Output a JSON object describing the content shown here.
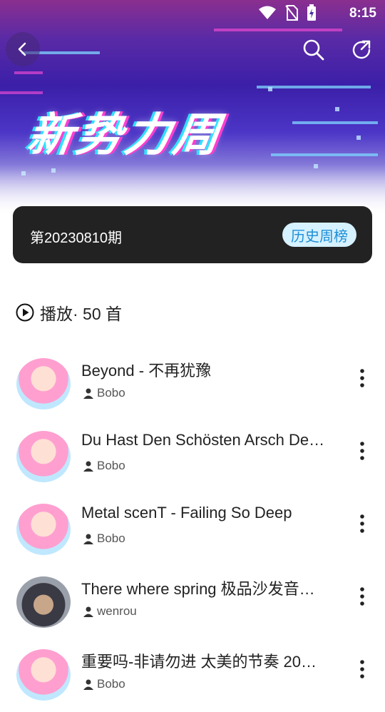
{
  "status": {
    "time": "8:15"
  },
  "header": {
    "banner_title": "新势力周",
    "icons": {
      "back": "back-chevron-icon",
      "search": "search-icon",
      "share": "share-icon"
    }
  },
  "period": {
    "label": "第20230810期",
    "history_button": "历史周榜"
  },
  "play_all": {
    "label": "播放· 50 首",
    "icon": "play-circle-icon"
  },
  "songs": [
    {
      "title": "Beyond - 不再犹豫",
      "artist": "Bobo"
    },
    {
      "title": "Du Hast Den Schösten Arsch De…",
      "artist": "Bobo"
    },
    {
      "title": "Metal scenT - Failing So Deep",
      "artist": "Bobo"
    },
    {
      "title": "There  where spring 极品沙发音…",
      "artist": "wenrou"
    },
    {
      "title": "重要吗-非请勿进 太美的节奏 20…",
      "artist": "Bobo"
    }
  ],
  "colors": {
    "card_bg": "#222222",
    "history_bg": "#d6f1ff",
    "history_text": "#1f8fd6"
  }
}
